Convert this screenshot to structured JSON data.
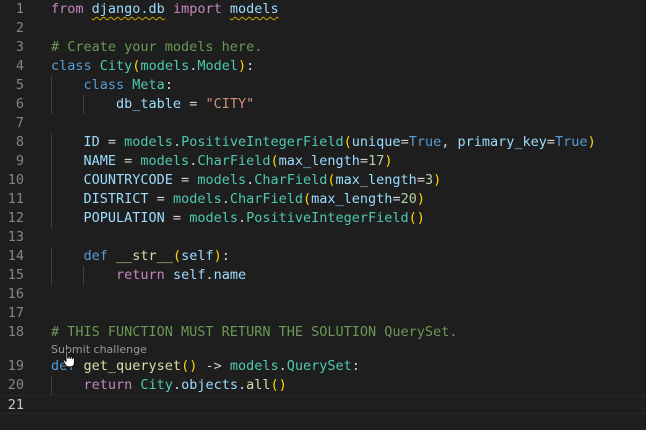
{
  "editor": {
    "language": "python",
    "current_line": 21,
    "codelens": {
      "label": "Submit challenge"
    },
    "lines": [
      {
        "number": "1",
        "tokens": [
          {
            "text": "from ",
            "role": "kw2"
          },
          {
            "text": "django.db",
            "role": "var",
            "squiggle": true
          },
          {
            "text": " ",
            "role": ""
          },
          {
            "text": "import",
            "role": "kw2"
          },
          {
            "text": " ",
            "role": ""
          },
          {
            "text": "models",
            "role": "var",
            "squiggle": true
          }
        ]
      },
      {
        "number": "2",
        "tokens": []
      },
      {
        "number": "3",
        "tokens": [
          {
            "text": "# Create your models here.",
            "role": "cmt"
          }
        ]
      },
      {
        "number": "4",
        "tokens": [
          {
            "text": "class ",
            "role": "kw"
          },
          {
            "text": "City",
            "role": "cls"
          },
          {
            "text": "(",
            "role": "p1"
          },
          {
            "text": "models",
            "role": "cls"
          },
          {
            "text": ".",
            "role": ""
          },
          {
            "text": "Model",
            "role": "cls"
          },
          {
            "text": ")",
            "role": "p1"
          },
          {
            "text": ":",
            "role": ""
          }
        ]
      },
      {
        "number": "5",
        "tokens": [
          {
            "text": "    ",
            "role": ""
          },
          {
            "text": "class ",
            "role": "kw"
          },
          {
            "text": "Meta",
            "role": "cls"
          },
          {
            "text": ":",
            "role": ""
          }
        ]
      },
      {
        "number": "6",
        "tokens": [
          {
            "text": "        ",
            "role": ""
          },
          {
            "text": "db_table",
            "role": "var"
          },
          {
            "text": " = ",
            "role": ""
          },
          {
            "text": "\"CITY\"",
            "role": "str"
          }
        ]
      },
      {
        "number": "7",
        "tokens": []
      },
      {
        "number": "8",
        "tokens": [
          {
            "text": "    ",
            "role": ""
          },
          {
            "text": "ID",
            "role": "var"
          },
          {
            "text": " = ",
            "role": ""
          },
          {
            "text": "models",
            "role": "cls"
          },
          {
            "text": ".",
            "role": ""
          },
          {
            "text": "PositiveIntegerField",
            "role": "cls"
          },
          {
            "text": "(",
            "role": "p1"
          },
          {
            "text": "unique",
            "role": "var"
          },
          {
            "text": "=",
            "role": ""
          },
          {
            "text": "True",
            "role": "kw"
          },
          {
            "text": ", ",
            "role": ""
          },
          {
            "text": "primary_key",
            "role": "var"
          },
          {
            "text": "=",
            "role": ""
          },
          {
            "text": "True",
            "role": "kw"
          },
          {
            "text": ")",
            "role": "p1"
          }
        ]
      },
      {
        "number": "9",
        "tokens": [
          {
            "text": "    ",
            "role": ""
          },
          {
            "text": "NAME",
            "role": "var"
          },
          {
            "text": " = ",
            "role": ""
          },
          {
            "text": "models",
            "role": "cls"
          },
          {
            "text": ".",
            "role": ""
          },
          {
            "text": "CharField",
            "role": "cls"
          },
          {
            "text": "(",
            "role": "p1"
          },
          {
            "text": "max_length",
            "role": "var"
          },
          {
            "text": "=",
            "role": ""
          },
          {
            "text": "17",
            "role": "num"
          },
          {
            "text": ")",
            "role": "p1"
          }
        ]
      },
      {
        "number": "10",
        "tokens": [
          {
            "text": "    ",
            "role": ""
          },
          {
            "text": "COUNTRYCODE",
            "role": "var"
          },
          {
            "text": " = ",
            "role": ""
          },
          {
            "text": "models",
            "role": "cls"
          },
          {
            "text": ".",
            "role": ""
          },
          {
            "text": "CharField",
            "role": "cls"
          },
          {
            "text": "(",
            "role": "p1"
          },
          {
            "text": "max_length",
            "role": "var"
          },
          {
            "text": "=",
            "role": ""
          },
          {
            "text": "3",
            "role": "num"
          },
          {
            "text": ")",
            "role": "p1"
          }
        ]
      },
      {
        "number": "11",
        "tokens": [
          {
            "text": "    ",
            "role": ""
          },
          {
            "text": "DISTRICT",
            "role": "var"
          },
          {
            "text": " = ",
            "role": ""
          },
          {
            "text": "models",
            "role": "cls"
          },
          {
            "text": ".",
            "role": ""
          },
          {
            "text": "CharField",
            "role": "cls"
          },
          {
            "text": "(",
            "role": "p1"
          },
          {
            "text": "max_length",
            "role": "var"
          },
          {
            "text": "=",
            "role": ""
          },
          {
            "text": "20",
            "role": "num"
          },
          {
            "text": ")",
            "role": "p1"
          }
        ]
      },
      {
        "number": "12",
        "tokens": [
          {
            "text": "    ",
            "role": ""
          },
          {
            "text": "POPULATION",
            "role": "var"
          },
          {
            "text": " = ",
            "role": ""
          },
          {
            "text": "models",
            "role": "cls"
          },
          {
            "text": ".",
            "role": ""
          },
          {
            "text": "PositiveIntegerField",
            "role": "cls"
          },
          {
            "text": "()",
            "role": "p1"
          }
        ]
      },
      {
        "number": "13",
        "tokens": []
      },
      {
        "number": "14",
        "tokens": [
          {
            "text": "    ",
            "role": ""
          },
          {
            "text": "def ",
            "role": "kw"
          },
          {
            "text": "__str__",
            "role": "fn"
          },
          {
            "text": "(",
            "role": "p1"
          },
          {
            "text": "self",
            "role": "var"
          },
          {
            "text": ")",
            "role": "p1"
          },
          {
            "text": ":",
            "role": ""
          }
        ]
      },
      {
        "number": "15",
        "tokens": [
          {
            "text": "        ",
            "role": ""
          },
          {
            "text": "return ",
            "role": "kw2"
          },
          {
            "text": "self",
            "role": "var"
          },
          {
            "text": ".",
            "role": ""
          },
          {
            "text": "name",
            "role": "var"
          }
        ]
      },
      {
        "number": "16",
        "tokens": []
      },
      {
        "number": "17",
        "tokens": []
      },
      {
        "number": "18",
        "tokens": [
          {
            "text": "# THIS FUNCTION MUST RETURN THE SOLUTION QuerySet.",
            "role": "cmt"
          }
        ]
      },
      {
        "number": "19",
        "tokens": [
          {
            "text": "def ",
            "role": "kw"
          },
          {
            "text": "get_queryset",
            "role": "fn"
          },
          {
            "text": "()",
            "role": "p1"
          },
          {
            "text": " -> ",
            "role": ""
          },
          {
            "text": "models",
            "role": "cls"
          },
          {
            "text": ".",
            "role": ""
          },
          {
            "text": "QuerySet",
            "role": "cls"
          },
          {
            "text": ":",
            "role": ""
          }
        ]
      },
      {
        "number": "20",
        "tokens": [
          {
            "text": "    ",
            "role": ""
          },
          {
            "text": "return ",
            "role": "kw2"
          },
          {
            "text": "City",
            "role": "cls"
          },
          {
            "text": ".",
            "role": ""
          },
          {
            "text": "objects",
            "role": "var"
          },
          {
            "text": ".",
            "role": ""
          },
          {
            "text": "all",
            "role": "fn"
          },
          {
            "text": "()",
            "role": "p1"
          }
        ]
      },
      {
        "number": "21",
        "tokens": []
      }
    ]
  }
}
